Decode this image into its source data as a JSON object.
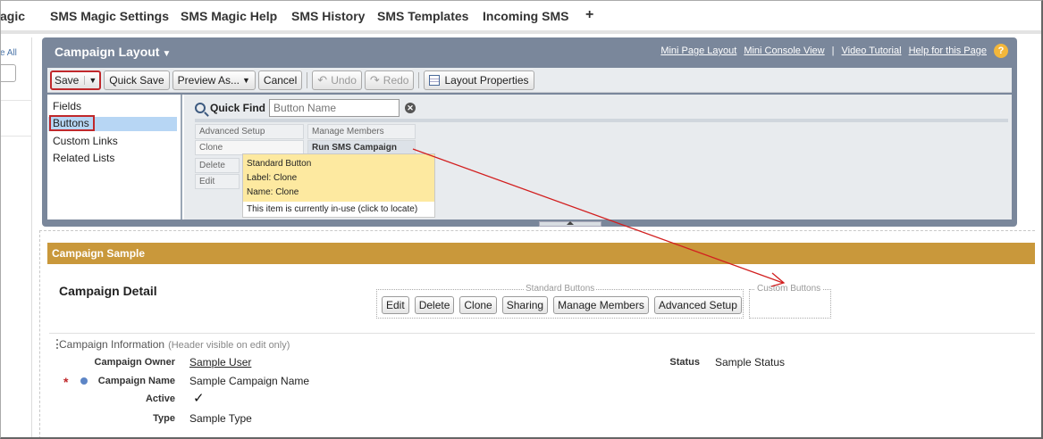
{
  "top_tabs": [
    "agic",
    "SMS Magic Settings",
    "SMS Magic Help",
    "SMS History",
    "SMS Templates",
    "Incoming SMS"
  ],
  "top_plus": "+",
  "left_stub": {
    "all_label": "e All"
  },
  "editor": {
    "title": "Campaign Layout",
    "caret": "▼",
    "links": {
      "mini_page": "Mini Page Layout",
      "mini_console": "Mini Console View",
      "sep": "|",
      "video": "Video Tutorial",
      "help": "Help for this Page"
    },
    "help_icon": "?",
    "toolbar": {
      "save": "Save",
      "quick_save": "Quick Save",
      "preview": "Preview As...",
      "cancel": "Cancel",
      "undo": "Undo",
      "redo": "Redo",
      "layout_props": "Layout Properties"
    },
    "palette_items": [
      "Fields",
      "Buttons",
      "Custom Links",
      "Related Lists"
    ],
    "quick_find": {
      "label": "Quick Find",
      "placeholder": "Button Name"
    },
    "cells": {
      "advanced_setup": "Advanced Setup",
      "manage_members": "Manage Members",
      "clone": "Clone",
      "run_sms": "Run SMS Campaign",
      "delete": "Delete",
      "edit": "Edit"
    },
    "tooltip": {
      "line1": "Standard Button",
      "line2": "Label: Clone",
      "line3": "Name: Clone",
      "note": "This item is currently in-use (click to locate)"
    }
  },
  "main": {
    "bar_title": "Campaign Sample",
    "detail_title": "Campaign Detail",
    "standard_buttons_label": "Standard Buttons",
    "standard_buttons": [
      "Edit",
      "Delete",
      "Clone",
      "Sharing",
      "Manage Members",
      "Advanced Setup"
    ],
    "custom_buttons_label": "Custom Buttons",
    "section_title": "Campaign Information",
    "section_sub": "(Header visible on edit only)",
    "fields": {
      "owner_label": "Campaign Owner",
      "owner_value": "Sample User",
      "status_label": "Status",
      "status_value": "Sample Status",
      "name_label": "Campaign Name",
      "name_value": "Sample Campaign Name",
      "active_label": "Active",
      "active_check": "✓",
      "type_label": "Type",
      "type_value": "Sample Type"
    },
    "required_mark": "*"
  },
  "colors": {
    "editor_header": "#7a879b",
    "section_bar": "#c9983b",
    "highlight": "#c0282b",
    "selected_item": "#b7d6f4",
    "tooltip": "#fde9a0"
  }
}
